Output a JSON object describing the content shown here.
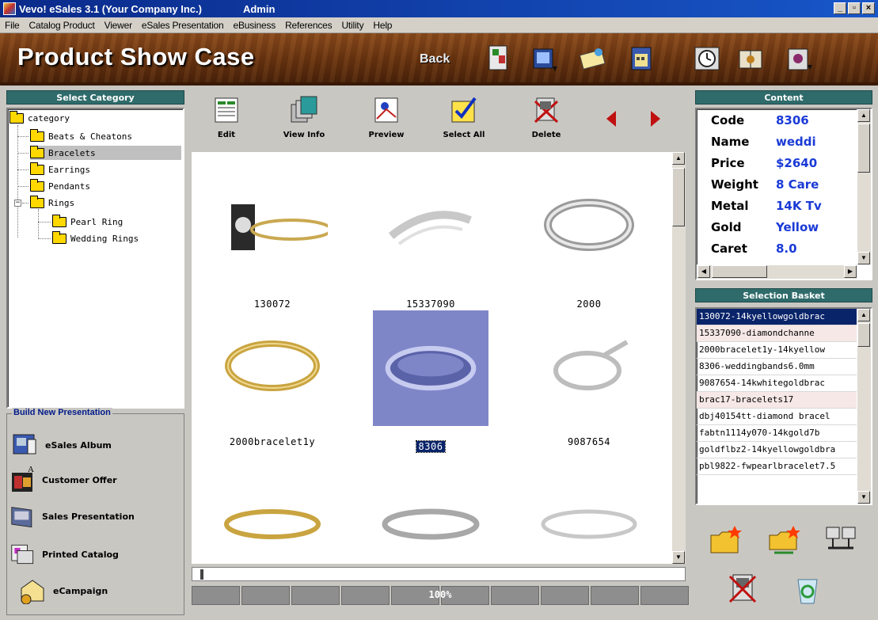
{
  "window": {
    "title": "Vevo! eSales 3.1 (Your Company Inc.)",
    "user": "Admin",
    "controls": [
      "_",
      "3",
      "x"
    ]
  },
  "menu": [
    "File",
    "Catalog Product",
    "Viewer",
    "eSales Presentation",
    "eBusiness",
    "References",
    "Utility",
    "Help"
  ],
  "banner": {
    "title": "Product Show Case",
    "back_label": "Back"
  },
  "left": {
    "header": "Select Category",
    "tree": {
      "root": "category",
      "items": [
        "Beats & Cheatons",
        "Bracelets",
        "Earrings",
        "Pendants",
        "Rings"
      ],
      "ring_children": [
        "Pearl Ring",
        "Wedding Rings"
      ],
      "selected": "Bracelets",
      "expander": "−"
    },
    "build": {
      "legend": "Build New Presentation",
      "items": [
        "eSales Album",
        "Customer Offer",
        "Sales Presentation",
        "Printed Catalog",
        "eCampaign"
      ],
      "offer_badge": "A"
    }
  },
  "toolbar": {
    "items": [
      "Edit",
      "View Info",
      "Preview",
      "Select All",
      "Delete"
    ]
  },
  "products": {
    "items": [
      "130072",
      "15337090",
      "2000",
      "2000bracelet1y",
      "8306",
      "9087654"
    ],
    "selected": "8306"
  },
  "status": {
    "progress_label": "100%",
    "progress_percent": 100
  },
  "right": {
    "content_header": "Content",
    "details": [
      {
        "k": "Code",
        "v": "8306"
      },
      {
        "k": "Name",
        "v": "weddi"
      },
      {
        "k": "Price",
        "v": "$2640"
      },
      {
        "k": "Weight",
        "v": "8 Care"
      },
      {
        "k": "Metal",
        "v": "14K Tv"
      },
      {
        "k": "Gold",
        "v": "Yellow"
      },
      {
        "k": "Caret",
        "v": "8.0"
      }
    ],
    "basket_header": "Selection Basket",
    "basket": [
      "130072-14kyellowgoldbrac",
      "15337090-diamondchanne",
      "2000bracelet1y-14kyellow",
      "8306-weddingbands6.0mm",
      "9087654-14kwhitegoldbrac",
      "brac17-bracelets17",
      "dbj40154tt-diamond bracel",
      "fabtn1114y070-14kgold7b",
      "goldflbz2-14kyellowgoldbra",
      "pbl9822-fwpearlbracelet7.5"
    ]
  },
  "colors": {
    "title_bar": "#0a2a8a",
    "banner": "#6a3410",
    "panel_header": "#2f6b6b",
    "value_text": "#1a3ad6",
    "selection": "#0a246a"
  }
}
